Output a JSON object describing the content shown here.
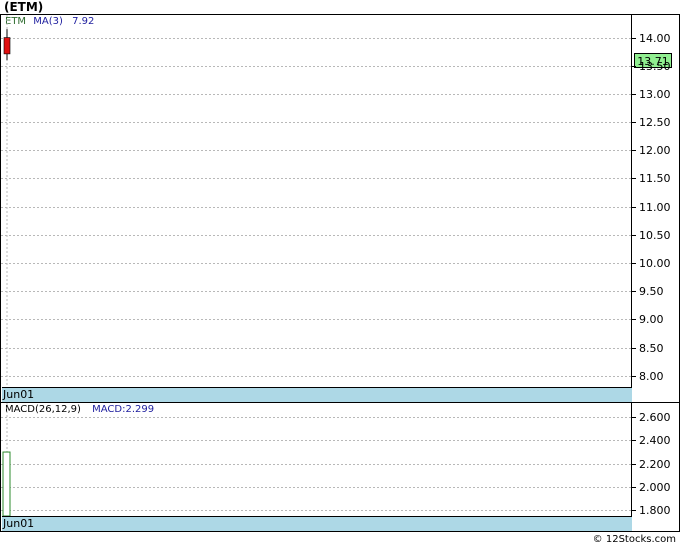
{
  "title": "(ETM)",
  "price_panel": {
    "legend_ticker": "ETM",
    "legend_ma_label": "MA(3)",
    "legend_ma_value": "7.92",
    "last_price": "13.71",
    "date_label": "Jun01",
    "y_ticks": [
      "14.00",
      "13.50",
      "13.00",
      "12.50",
      "12.00",
      "11.50",
      "11.00",
      "10.50",
      "10.00",
      "9.50",
      "9.00",
      "8.50",
      "8.00"
    ]
  },
  "macd_panel": {
    "legend_label": "MACD(26,12,9)",
    "legend_value": "MACD:2.299",
    "date_label": "Jun01",
    "y_ticks": [
      "2.600",
      "2.400",
      "2.200",
      "2.000",
      "1.800"
    ]
  },
  "footer": "© 12Stocks.com",
  "colors": {
    "candle_down": "#e01010",
    "macd_bar": "#2e8b2e",
    "ticker_legend": "#2e6b2e",
    "ma_legend": "#1e1e9e",
    "date_bar": "#add8e6",
    "last_price_bg": "#90ee90"
  },
  "chart_data": [
    {
      "type": "candlestick",
      "ylim": [
        7.8,
        14.4
      ],
      "candles": [
        {
          "date": "Jun01",
          "open": 14.0,
          "high": 14.15,
          "low": 13.6,
          "close": 13.71
        }
      ],
      "ma3": 7.92,
      "grid": true
    },
    {
      "type": "bar",
      "ylim": [
        1.75,
        2.72
      ],
      "categories": [
        "Jun01"
      ],
      "values": [
        2.299
      ],
      "grid": true
    }
  ]
}
